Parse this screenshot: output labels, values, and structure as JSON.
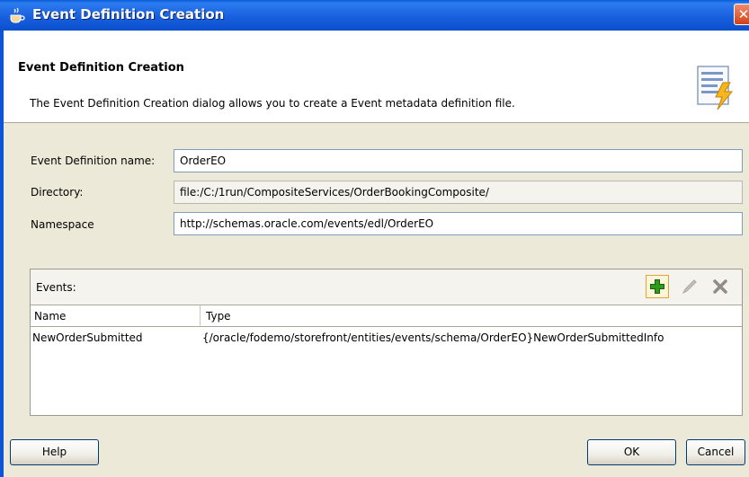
{
  "window": {
    "title": "Event Definition Creation",
    "close_label": "✕"
  },
  "header": {
    "title": "Event Definition Creation",
    "description": "The Event Definition Creation dialog allows you to create a Event metadata definition file."
  },
  "form": {
    "name_label": "Event Definition name:",
    "name_value": "OrderEO",
    "directory_label": "Directory:",
    "directory_value": "file:/C:/1run/CompositeServices/OrderBookingComposite/",
    "namespace_label": "Namespace",
    "namespace_value": "http://schemas.oracle.com/events/edl/OrderEO"
  },
  "events": {
    "label": "Events:",
    "columns": [
      "Name",
      "Type"
    ],
    "rows": [
      [
        "NewOrderSubmitted",
        "{/oracle/fodemo/storefront/entities/events/schema/OrderEO}NewOrderSubmittedInfo"
      ]
    ]
  },
  "buttons": {
    "help": "Help",
    "ok": "OK",
    "cancel": "Cancel"
  },
  "colors": {
    "titlebar": "#0A4FCE",
    "dialog_bg": "#ECE9D8",
    "add_green": "#2E9A1E"
  }
}
